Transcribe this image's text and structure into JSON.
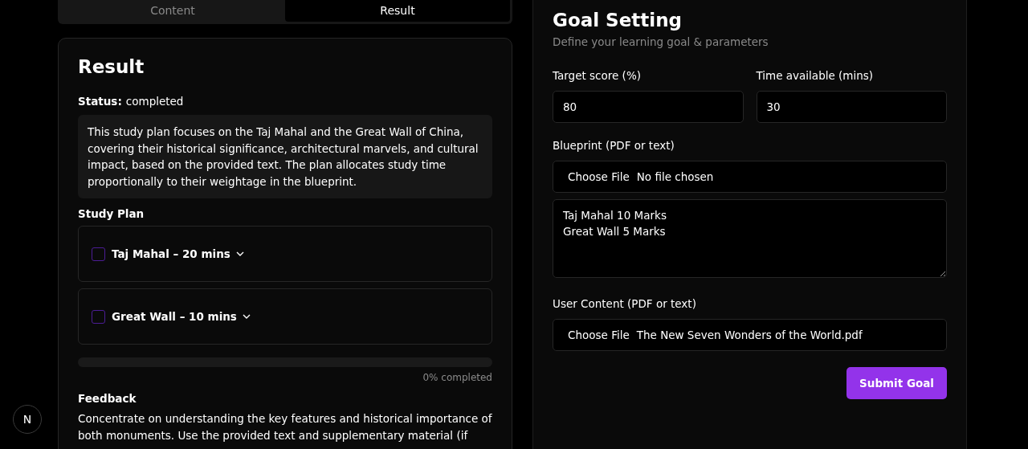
{
  "tabs": [
    {
      "label": "Content",
      "selected": false
    },
    {
      "label": "Result",
      "selected": true
    }
  ],
  "result": {
    "title": "Result",
    "status_label": "Status:",
    "status_value": "completed",
    "summary": "This study plan focuses on the Taj Mahal and the Great Wall of China, covering their historical significance, architectural marvels, and cultural impact, based on the provided text. The plan allocates study time proportionally to their weightage in the blueprint.",
    "study_plan_heading": "Study Plan",
    "study_plan": [
      {
        "label": "Taj Mahal – 20 mins",
        "checked": false,
        "expanded": false
      },
      {
        "label": "Great Wall – 10 mins",
        "checked": false,
        "expanded": false
      }
    ],
    "progress": {
      "level": 0,
      "reading": "0% completed"
    },
    "feedback_heading": "Feedback",
    "feedback": "Concentrate on understanding the key features and historical importance of both monuments. Use the provided text and supplementary material (if"
  },
  "goal_setting": {
    "title": "Goal Setting",
    "subtitle": "Define your learning goal & parameters",
    "target_score": {
      "label": "Target score (%)",
      "value": "80"
    },
    "time_available": {
      "label": "Time available (mins)",
      "value": "30"
    },
    "blueprint": {
      "label": "Blueprint (PDF or text)",
      "button": "Choose File",
      "file": "No file chosen",
      "text": "Taj Mahal 10 Marks\nGreat Wall 5 Marks"
    },
    "user_content": {
      "label": "User Content (PDF or text)",
      "button": "Choose File",
      "file": "The New Seven Wonders of the World.pdf"
    },
    "submit": "Submit Goal"
  },
  "dev_badge": {
    "label": "N"
  }
}
